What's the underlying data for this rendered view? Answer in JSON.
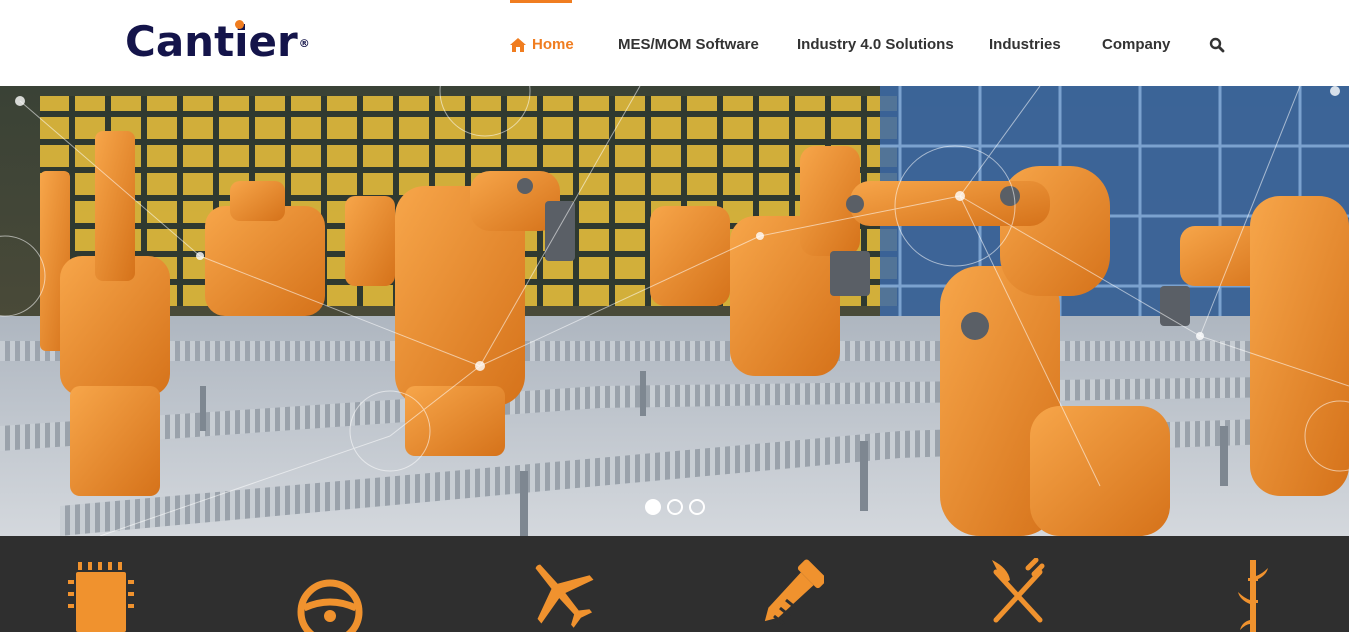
{
  "brand": {
    "name": "Cantier",
    "registered": "®",
    "accent": "#f07d20",
    "navy": "#14144a"
  },
  "nav": {
    "items": [
      {
        "label": "Home",
        "icon": "home-icon",
        "active": true
      },
      {
        "label": "MES/MOM Software"
      },
      {
        "label": "Industry 4.0 Solutions"
      },
      {
        "label": "Industries"
      },
      {
        "label": "Company"
      }
    ],
    "search_icon": "search-icon"
  },
  "hero": {
    "image": "robotic-assembly-line",
    "slides": 3,
    "active_slide": 1
  },
  "industries": {
    "background": "#2f2f2f",
    "icons": [
      "microchip-icon",
      "steering-wheel-icon",
      "airplane-icon",
      "screw-icon",
      "fork-knife-icon",
      "bamboo-icon"
    ]
  }
}
